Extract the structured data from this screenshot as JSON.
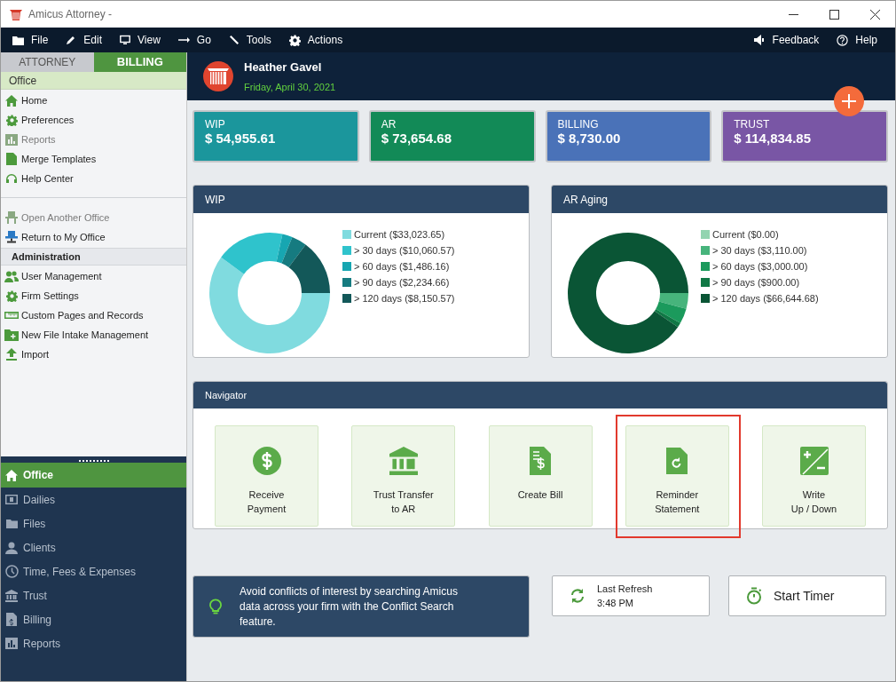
{
  "window": {
    "title": "Amicus Attorney -"
  },
  "menu_bar": {
    "left": [
      {
        "label": "File"
      },
      {
        "label": "Edit"
      },
      {
        "label": "View"
      },
      {
        "label": "Go"
      },
      {
        "label": "Tools"
      },
      {
        "label": "Actions"
      }
    ],
    "right": [
      {
        "label": "Feedback"
      },
      {
        "label": "Help"
      }
    ]
  },
  "sidebar": {
    "tabs": [
      {
        "label": "ATTORNEY",
        "selected": false
      },
      {
        "label": "BILLING",
        "selected": true
      }
    ],
    "section_title": "Office",
    "groups": [
      {
        "items": [
          {
            "label": "Home",
            "disabled": false
          },
          {
            "label": "Preferences",
            "disabled": false
          },
          {
            "label": "Reports",
            "disabled": true
          },
          {
            "label": "Merge Templates",
            "disabled": false
          },
          {
            "label": "Help Center",
            "disabled": false
          }
        ]
      },
      {
        "items": [
          {
            "label": "Open Another Office",
            "disabled": true
          },
          {
            "label": "Return to My Office",
            "disabled": false
          }
        ]
      },
      {
        "header": "Administration",
        "items": [
          {
            "label": "User Management",
            "disabled": false
          },
          {
            "label": "Firm Settings",
            "disabled": false
          },
          {
            "label": "Custom Pages and Records",
            "disabled": false
          },
          {
            "label": "New File Intake Management",
            "disabled": false
          },
          {
            "label": "Import",
            "disabled": false
          }
        ]
      }
    ],
    "nav": [
      {
        "label": "Office",
        "selected": true
      },
      {
        "label": "Dailies",
        "selected": false
      },
      {
        "label": "Files",
        "selected": false
      },
      {
        "label": "Clients",
        "selected": false
      },
      {
        "label": "Time, Fees & Expenses",
        "selected": false
      },
      {
        "label": "Trust",
        "selected": false
      },
      {
        "label": "Billing",
        "selected": false
      },
      {
        "label": "Reports",
        "selected": false
      }
    ]
  },
  "header": {
    "user_name": "Heather Gavel",
    "date": "Friday, April 30, 2021"
  },
  "summary_cards": [
    {
      "label": "WIP",
      "amount": "$ 54,955.61",
      "color": "#1b969c"
    },
    {
      "label": "AR",
      "amount": "$ 73,654.68",
      "color": "#128a57"
    },
    {
      "label": "BILLING",
      "amount": "$ 8,730.00",
      "color": "#4a72b8"
    },
    {
      "label": "TRUST",
      "amount": "$ 114,834.85",
      "color": "#7956a5"
    }
  ],
  "charts": [
    {
      "title": "WIP",
      "chart_data": {
        "type": "donut",
        "categories": [
          "Current ($33,023.65)",
          "> 30 days ($10,060.57)",
          "> 60 days ($1,486.16)",
          "> 90 days ($2,234.66)",
          "> 120 days ($8,150.57)"
        ],
        "values": [
          33023.65,
          10060.57,
          1486.16,
          2234.66,
          8150.57
        ],
        "legend": "right",
        "colors": [
          "#80dbdf",
          "#2fc3cc",
          "#17a6b1",
          "#167b80",
          "#135859"
        ]
      }
    },
    {
      "title": "AR Aging",
      "chart_data": {
        "type": "donut",
        "categories": [
          "Current ($0.00)",
          "> 30 days ($3,110.00)",
          "> 60 days ($3,000.00)",
          "> 90 days ($900.00)",
          "> 120 days ($66,644.68)"
        ],
        "values": [
          0,
          3110,
          3000,
          900,
          66644.68
        ],
        "legend": "right",
        "colors": [
          "#93d4b0",
          "#47b47c",
          "#1b9a5c",
          "#107845",
          "#0a5535"
        ]
      }
    }
  ],
  "navigator": {
    "title": "Navigator",
    "tiles": [
      {
        "label": "Receive\nPayment",
        "highlighted": false
      },
      {
        "label": "Trust Transfer\nto AR",
        "highlighted": false
      },
      {
        "label": "Create Bill",
        "highlighted": false
      },
      {
        "label": "Reminder\nStatement",
        "highlighted": true
      },
      {
        "label": "Write\nUp / Down",
        "highlighted": false
      }
    ]
  },
  "tip": {
    "text": "Avoid conflicts of interest by searching Amicus data across your firm with the Conflict Search feature."
  },
  "refresh": {
    "label": "Last Refresh",
    "time": "3:48 PM"
  },
  "timer_button": {
    "label": "Start Timer"
  }
}
